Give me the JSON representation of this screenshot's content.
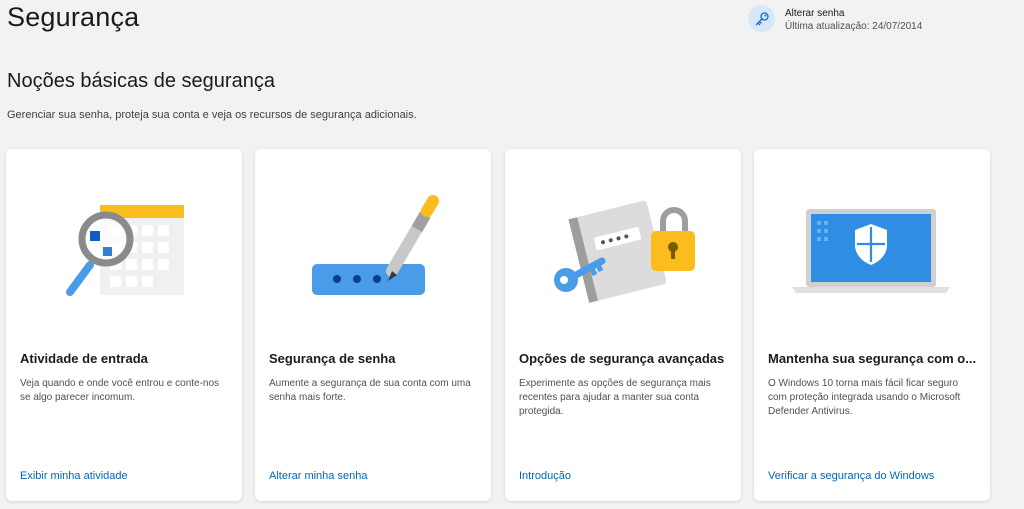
{
  "header": {
    "title": "Segurança",
    "password_widget": {
      "icon": "key-icon",
      "title": "Alterar senha",
      "subtitle": "Última atualização: 24/07/2014"
    }
  },
  "section": {
    "title": "Noções básicas de segurança",
    "description": "Gerenciar sua senha, proteja sua conta e veja os recursos de segurança adicionais."
  },
  "cards": [
    {
      "title": "Atividade de entrada",
      "description": "Veja quando e onde você entrou e conte-nos se algo parecer incomum.",
      "link": "Exibir minha atividade",
      "illustration": "calendar-magnifier-icon"
    },
    {
      "title": "Segurança de senha",
      "description": "Aumente a segurança de sua conta com uma senha mais forte.",
      "link": "Alterar minha senha",
      "illustration": "password-pen-icon"
    },
    {
      "title": "Opções de segurança avançadas",
      "description": "Experimente as opções de segurança mais recentes para ajudar a manter sua conta protegida.",
      "link": "Introdução",
      "illustration": "notebook-lock-key-icon"
    },
    {
      "title": "Mantenha sua segurança com o...",
      "description": "O Windows 10 torna mais fácil ficar seguro com proteção integrada usando o Microsoft Defender Antivirus.",
      "link": "Verificar a segurança do Windows",
      "illustration": "laptop-shield-icon"
    }
  ],
  "colors": {
    "background": "#f2f2f2",
    "link": "#0067b8",
    "accent_blue": "#4a9ce8",
    "accent_yellow": "#fbbd1e"
  }
}
